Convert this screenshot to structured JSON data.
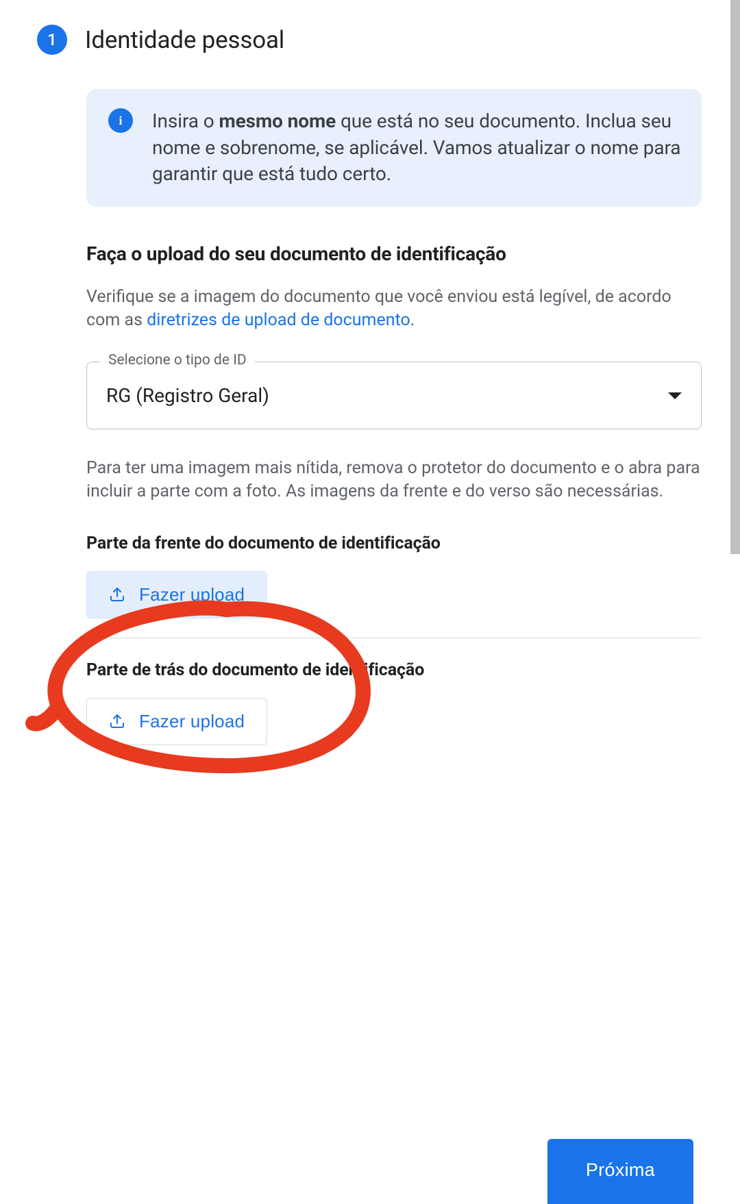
{
  "step": {
    "number": "1",
    "title": "Identidade pessoal"
  },
  "info": {
    "text_prefix": "Insira o ",
    "text_bold": "mesmo nome",
    "text_suffix": " que está no seu documento. Inclua seu nome e sobrenome, se aplicável. Vamos atualizar o nome para garantir que está tudo certo."
  },
  "upload_section": {
    "heading": "Faça o upload do seu documento de identificação",
    "helper_prefix": "Verifique se a imagem do documento que você enviou está legível, de acordo com as ",
    "helper_link": "diretrizes de upload de documento",
    "helper_suffix": "."
  },
  "select": {
    "label": "Selecione o tipo de ID",
    "value": "RG (Registro Geral)"
  },
  "instructions": "Para ter uma imagem mais nítida, remova o protetor do documento e o abra para incluir a parte com a foto. As imagens da frente e do verso são necessárias.",
  "front": {
    "heading": "Parte da frente do documento de identificação",
    "button": "Fazer upload"
  },
  "back": {
    "heading": "Parte de trás do documento de identificação",
    "button": "Fazer upload"
  },
  "next": "Próxima"
}
